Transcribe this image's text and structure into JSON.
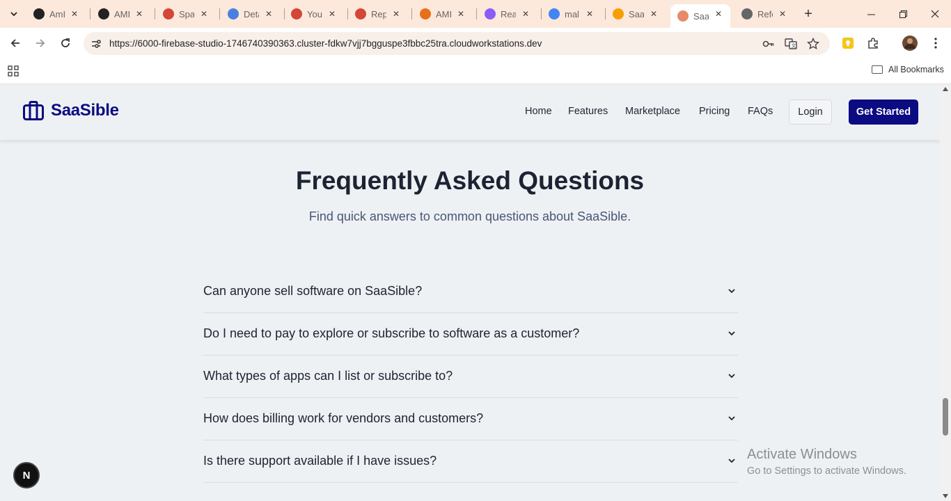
{
  "browser": {
    "tabs": [
      {
        "label": "AmI",
        "icon": "openai-icon",
        "color": "#222222"
      },
      {
        "label": "AMI",
        "icon": "github-icon",
        "color": "#222222"
      },
      {
        "label": "Spa",
        "icon": "gmail-icon",
        "color": "#d44638"
      },
      {
        "label": "Deta",
        "icon": "chrome-settings-icon",
        "color": "#4a7fe0"
      },
      {
        "label": "You",
        "icon": "gmail-icon",
        "color": "#d44638"
      },
      {
        "label": "Rep",
        "icon": "gmail-icon",
        "color": "#d44638"
      },
      {
        "label": "AMI",
        "icon": "orange-app-icon",
        "color": "#e8701a"
      },
      {
        "label": "Rea",
        "icon": "vite-icon",
        "color": "#8b5cf6"
      },
      {
        "label": "mal",
        "icon": "google-icon",
        "color": "#4285f4"
      },
      {
        "label": "Saa",
        "icon": "firebase-icon",
        "color": "#f5a000"
      },
      {
        "label": "Saa",
        "icon": "firebase-studio-icon",
        "color": "#e58a6a",
        "active": true
      },
      {
        "label": "Refe",
        "icon": "globe-icon",
        "color": "#666666"
      }
    ],
    "url": "https://6000-firebase-studio-1746740390363.cluster-fdkw7vjj7bgguspe3fbbc25tra.cloudworkstations.dev",
    "all_bookmarks": "All Bookmarks"
  },
  "site": {
    "brand": "SaaSible",
    "brand_color": "#0b0b82",
    "nav": [
      "Home",
      "Features",
      "Marketplace",
      "Pricing",
      "FAQs"
    ],
    "login": "Login",
    "get_started": "Get Started"
  },
  "faq": {
    "title": "Frequently Asked Questions",
    "subtitle": "Find quick answers to common questions about SaaSible.",
    "questions": [
      "Can anyone sell software on SaaSible?",
      "Do I need to pay to explore or subscribe to software as a customer?",
      "What types of apps can I list or subscribe to?",
      "How does billing work for vendors and customers?",
      "Is there support available if I have issues?"
    ]
  },
  "overlay": {
    "next_badge": "N",
    "activate_title": "Activate Windows",
    "activate_sub": "Go to Settings to activate Windows."
  }
}
